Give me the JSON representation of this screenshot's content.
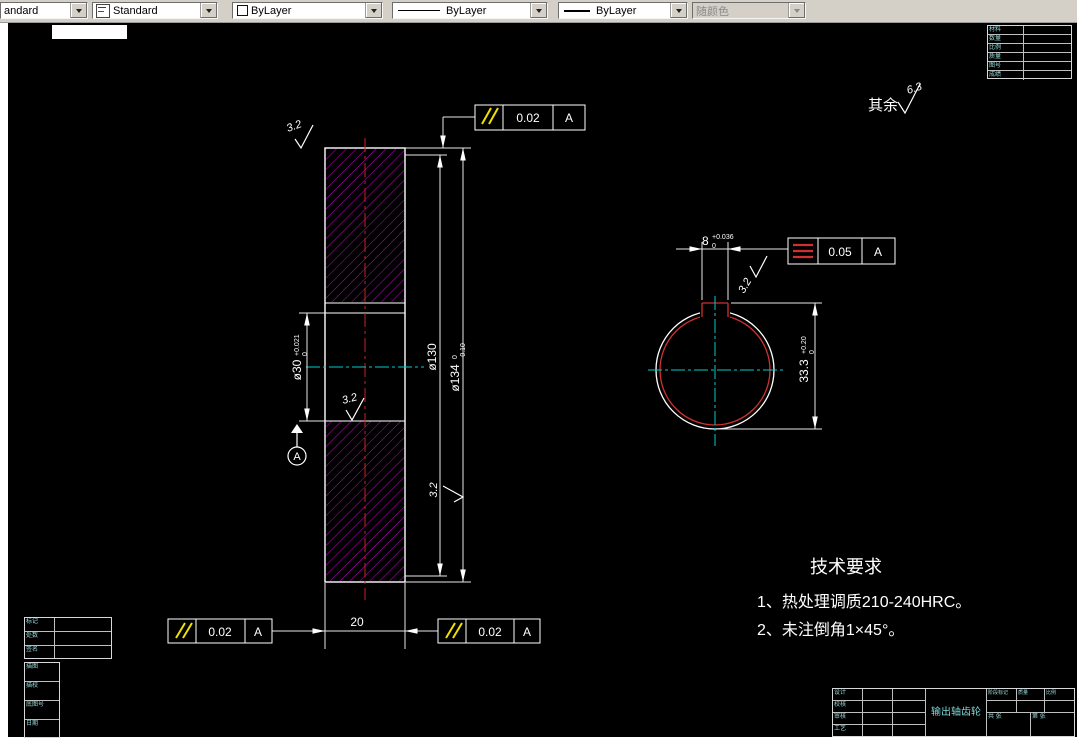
{
  "toolbar": {
    "dim_style": "andard",
    "text_style": "Standard",
    "color": "ByLayer",
    "linetype": "ByLayer",
    "lineweight": "ByLayer",
    "plot_style": "随颜色"
  },
  "colors": {
    "hatch": "#c400c4",
    "centerline_red": "#cc2222",
    "centerline_cyan": "#00cccc",
    "bore_circle": "#d03030",
    "tolerance_symbol_yellow": "#f0e000"
  },
  "drawing": {
    "general_finish": {
      "label": "其余",
      "value": "6.3"
    },
    "finish_values": {
      "top": "3.2",
      "bore": "3.2",
      "od": "3.2",
      "keyway": "3.2"
    },
    "datum_label": "A",
    "tolerances": {
      "parallel_top": {
        "value": "0.02",
        "datum": "A"
      },
      "parallel_left": {
        "value": "0.02",
        "datum": "A"
      },
      "parallel_right": {
        "value": "0.02",
        "datum": "A"
      },
      "symmetry": {
        "value": "0.05",
        "datum": "A"
      }
    },
    "dimensions": {
      "bore_dia": {
        "text": "ø30",
        "upper": "+0.021",
        "lower": "0"
      },
      "pitch_dia": {
        "text": "ø130"
      },
      "outer_dia": {
        "text": "ø134",
        "upper": "0",
        "lower": "-0.10"
      },
      "width": {
        "text": "20"
      },
      "key_width": {
        "text": "8",
        "upper": "+0.036",
        "lower": "0"
      },
      "key_depth": {
        "text": "33.3",
        "upper": "+0.20",
        "lower": "0"
      }
    },
    "tech_req": {
      "title": "技术要求",
      "line1": "1、热处理调质210-240HRC。",
      "line2": "2、未注倒角1×45°。"
    }
  },
  "title_block": {
    "part_name": "输出轴齿轮",
    "sign_rows": [
      "设计",
      "校核",
      "审核",
      "工艺"
    ],
    "right_labels": {
      "stage": "阶段标记",
      "mass": "质量",
      "scale": "比例",
      "sheets": "共 张",
      "sheet": "第 张"
    },
    "corner_rows": [
      "材料",
      "数量",
      "比例",
      "质量",
      "图号",
      "成绩"
    ],
    "bl_table": [
      "标记",
      "处数",
      "签名"
    ],
    "bl_strip": [
      "描图",
      "描校",
      "底图号",
      "日期"
    ]
  }
}
